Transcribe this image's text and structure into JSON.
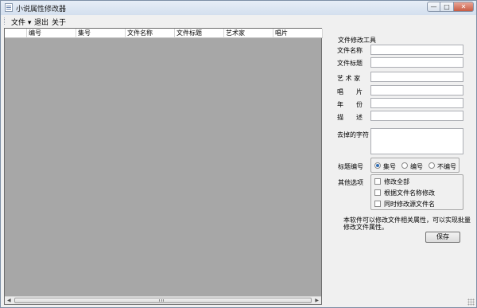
{
  "window": {
    "title": "小说属性修改器",
    "controls": {
      "minimize": "—",
      "maximize": "□",
      "close": "✕"
    }
  },
  "menu": {
    "items": [
      "文件 ▾",
      "退出",
      "关于"
    ]
  },
  "grid": {
    "columns": [
      "编号",
      "集号",
      "文件名称",
      "文件标题",
      "艺术家",
      "唱片"
    ]
  },
  "panel": {
    "section_title": "文件修改工具",
    "fields": [
      {
        "label": "文件名称",
        "value": ""
      },
      {
        "label": "文件标题",
        "value": ""
      },
      {
        "label": "艺 术 家",
        "value": ""
      },
      {
        "label": "唱　　片",
        "value": ""
      },
      {
        "label": "年　　份",
        "value": ""
      },
      {
        "label": "描　　述",
        "value": ""
      }
    ],
    "remove_chars_label": "去掉的字符",
    "remove_chars_value": "",
    "title_numbering": {
      "label": "标题编号",
      "options": [
        "集号",
        "编号",
        "不编号"
      ],
      "selected": "集号"
    },
    "other_options": {
      "label": "其他选项",
      "checkboxes": [
        {
          "label": "修改全部",
          "checked": false
        },
        {
          "label": "根据文件名称修改",
          "checked": false
        },
        {
          "label": "同时修改源文件名",
          "checked": false
        }
      ]
    },
    "description": "本软件可以修改文件相关属性，可以实现批量修改文件属性。",
    "save_button": "保存"
  }
}
